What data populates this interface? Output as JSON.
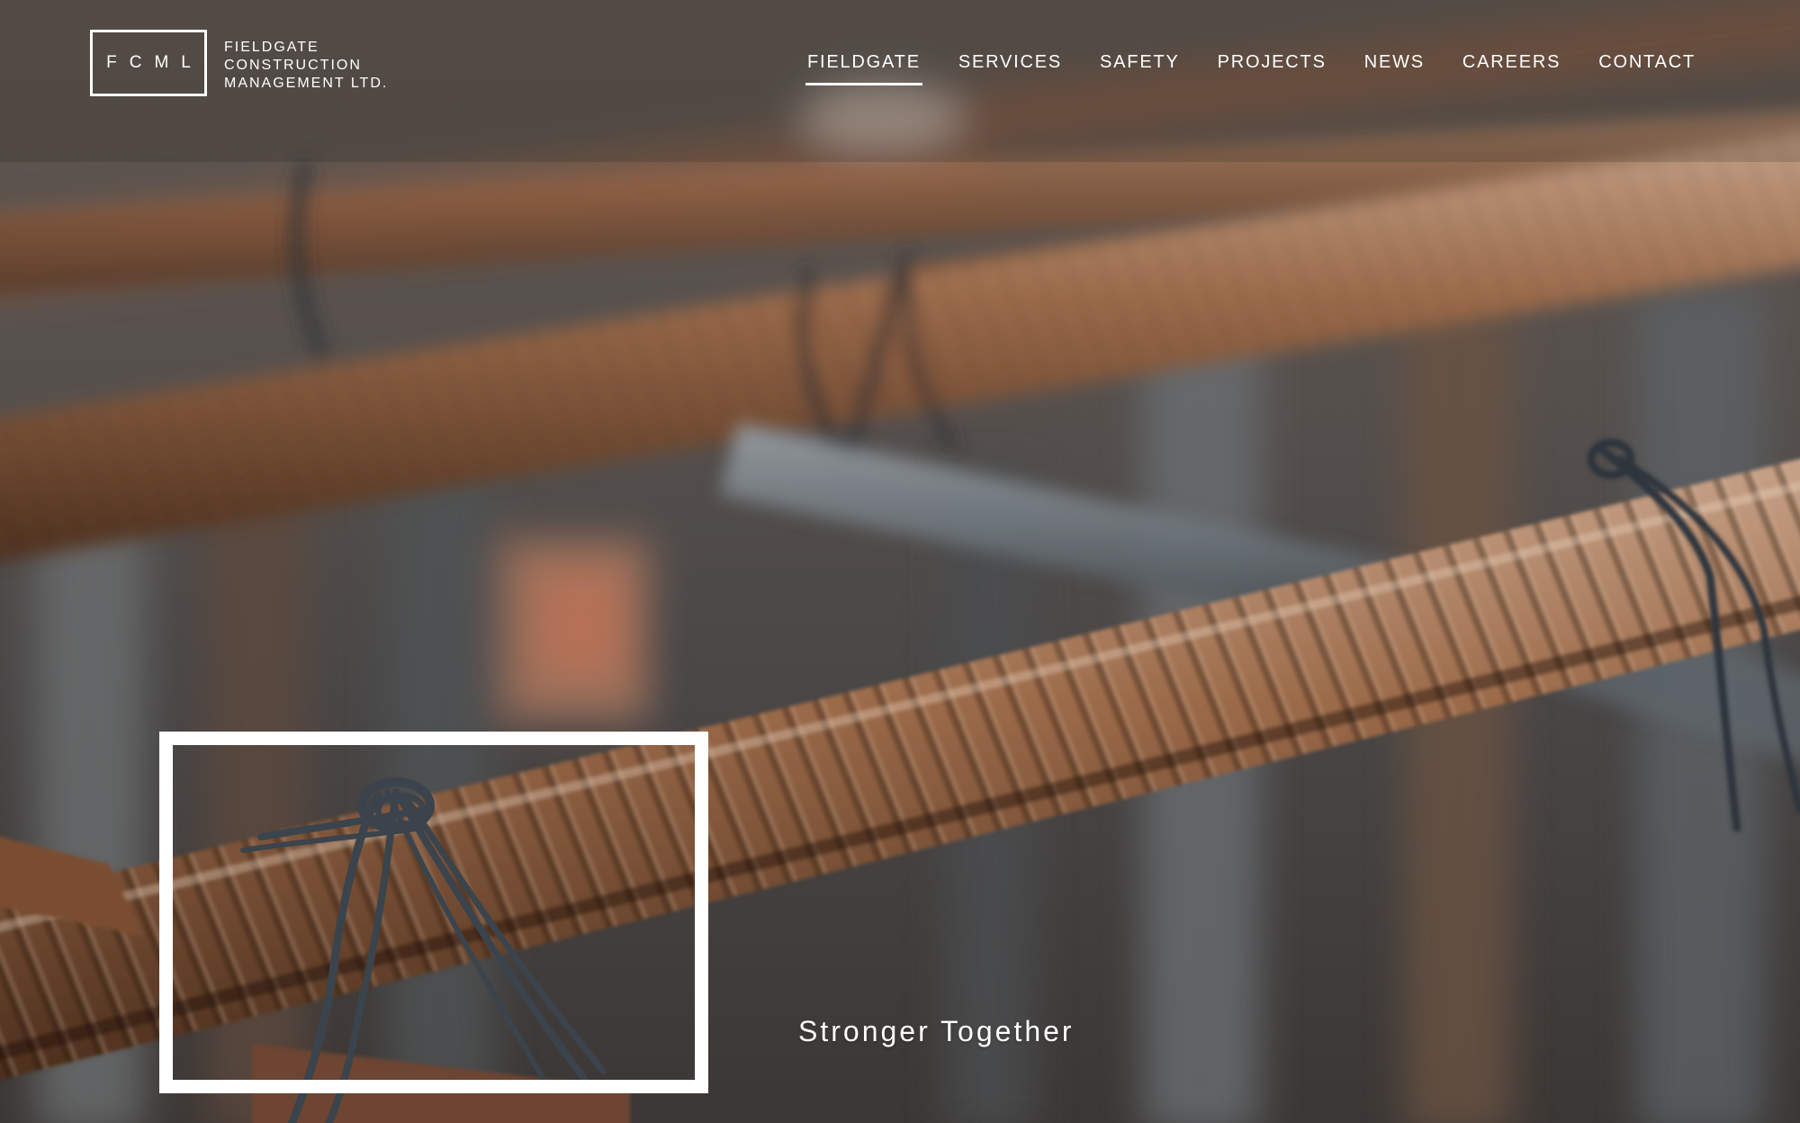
{
  "logo": {
    "monogram": "FCML",
    "name_lines": [
      "FIELDGATE",
      "CONSTRUCTION",
      "MANAGEMENT LTD."
    ]
  },
  "nav": {
    "items": [
      {
        "label": "FIELDGATE",
        "active": true
      },
      {
        "label": "SERVICES",
        "active": false
      },
      {
        "label": "SAFETY",
        "active": false
      },
      {
        "label": "PROJECTS",
        "active": false
      },
      {
        "label": "NEWS",
        "active": false
      },
      {
        "label": "CAREERS",
        "active": false
      },
      {
        "label": "CONTACT",
        "active": false
      }
    ]
  },
  "hero": {
    "tagline": "Stronger Together",
    "image": "rusted-rebar-tied-with-wire"
  },
  "colors": {
    "text": "#ffffff",
    "rust": "#8a5a3c",
    "steel": "#5b6670"
  }
}
